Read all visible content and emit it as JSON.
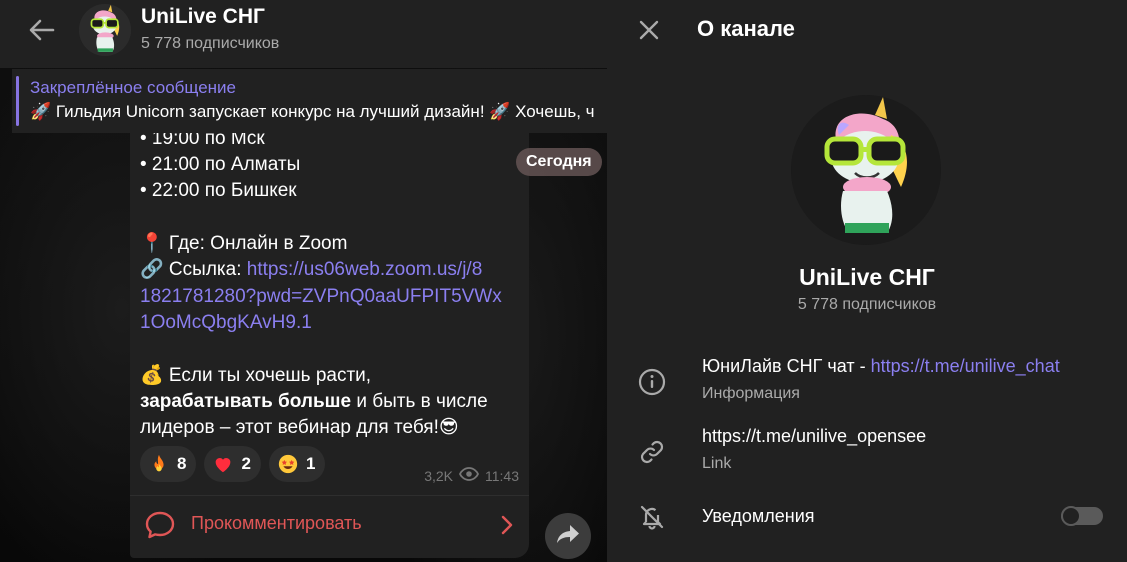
{
  "chat": {
    "header": {
      "title": "UniLive СНГ",
      "subscribers": "5 778 подписчиков"
    },
    "pinned": {
      "title": "Закреплённое сообщение",
      "text": "🚀 Гильдия Unicorn запускает конкурс на лучший дизайн! 🚀 Хочешь, ч"
    },
    "date_pill": "Сегодня",
    "message": {
      "line1": "• 19:00 по Мск",
      "line2": "• 21:00 по Алматы",
      "line3": "• 22:00 по Бишкек",
      "where": "📍 Где: Онлайн в Zoom",
      "link_label": "🔗 Ссылка: ",
      "link_part1": "https://us06web.zoom.us/j/8",
      "link_part2": "1821781280?pwd=ZVPnQ0aaUFPIT5VWx",
      "link_part3": "1OoMcQbgKAvH9.1",
      "p1": "💰 Если ты хочешь расти,",
      "p2_bold": "зарабатывать больше",
      "p2_rest": " и быть в числе",
      "p3": "лидеров – этот вебинар для тебя!😎"
    },
    "reactions": [
      {
        "emoji": "🔥",
        "count": "8"
      },
      {
        "emoji": "❤️",
        "count": "2"
      },
      {
        "emoji": "🤩",
        "count": "1"
      }
    ],
    "views": "3,2K",
    "time": "11:43",
    "comment_label": "Прокомментировать"
  },
  "panel": {
    "title": "О канале",
    "name": "UniLive СНГ",
    "subscribers": "5 778 подписчиков",
    "info_text": "ЮниЛайв СНГ чат - ",
    "info_link": "https://t.me/unilive_chat",
    "info_sub": "Информация",
    "link_text": "https://t.me/unilive_opensee",
    "link_sub": "Link",
    "notifications_label": "Уведомления",
    "notifications_on": false
  },
  "colors": {
    "accent": "#8774e1",
    "comment": "#e05656",
    "panel_bg": "#212121"
  }
}
